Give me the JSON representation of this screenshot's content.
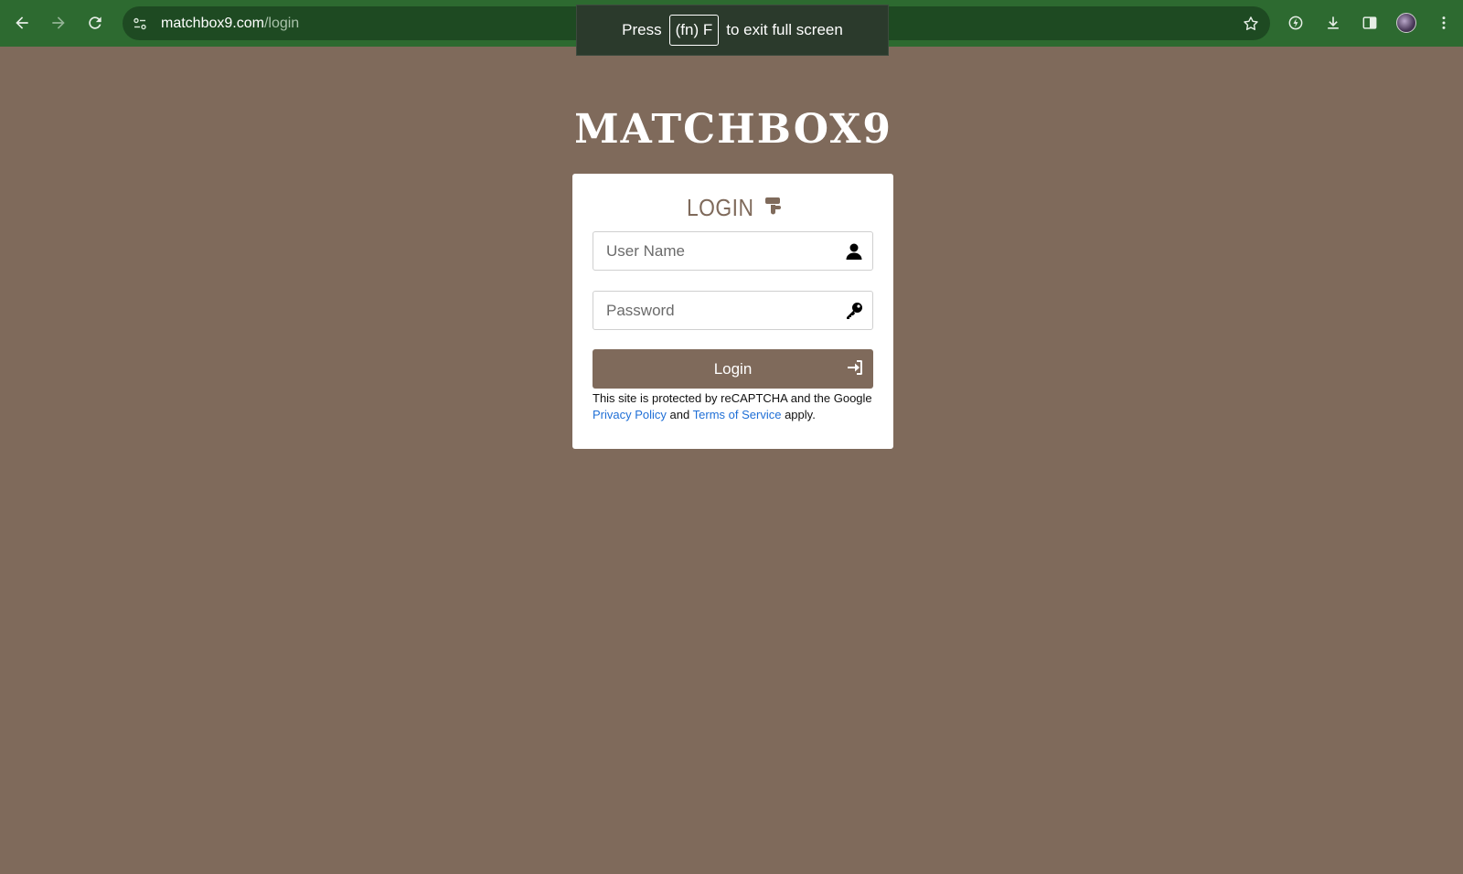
{
  "browser": {
    "url_domain": "matchbox9.com",
    "url_path": "/login"
  },
  "fullscreen_toast": {
    "prefix": "Press",
    "key": "(fn) F",
    "suffix": "to exit full screen"
  },
  "logo": {
    "text": "MATCHBOX9"
  },
  "login": {
    "title": "LOGIN",
    "username_placeholder": "User Name",
    "password_placeholder": "Password",
    "button_label": "Login",
    "recaptcha_text_1": "This site is protected by reCAPTCHA and the Google",
    "privacy_link": "Privacy Policy",
    "and_text": "and",
    "terms_link": "Terms of Service",
    "apply_text": "apply."
  },
  "colors": {
    "page_background": "#7f6a5b",
    "browser_frame": "#2d6a30",
    "accent": "#7f6a5b",
    "link": "#1f6fd6"
  }
}
